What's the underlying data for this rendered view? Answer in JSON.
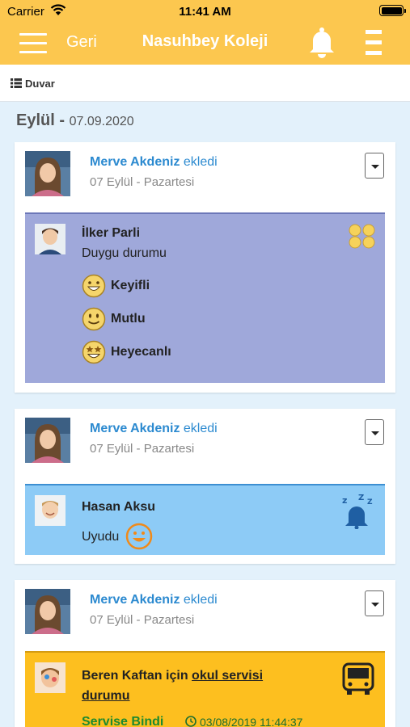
{
  "status": {
    "carrier": "Carrier",
    "time": "11:41 AM"
  },
  "nav": {
    "back_label": "Geri",
    "title": "Nasuhbey Koleji"
  },
  "section": {
    "label": "Duvar"
  },
  "date_header": {
    "month": "Eylül -",
    "date": "07.09.2020"
  },
  "posts": [
    {
      "author": "Merve Akdeniz",
      "action": "ekledi",
      "date": "07 Eylül - Pazartesi",
      "student": "İlker Parli",
      "subtitle": "Duygu durumu",
      "moods": [
        "Keyifli",
        "Mutlu",
        "Heyecanlı"
      ],
      "panel_color": "#9fa8da"
    },
    {
      "author": "Merve Akdeniz",
      "action": "ekledi",
      "date": "07 Eylül - Pazartesi",
      "student": "Hasan Aksu",
      "subtitle": "Uyudu",
      "panel_color": "#8dcbf6"
    },
    {
      "author": "Merve Akdeniz",
      "action": "ekledi",
      "date": "07 Eylül - Pazartesi",
      "student_line_prefix": "Beren Kaftan için",
      "link_text_1": "okul servisi",
      "link_text_2": "durumu",
      "status": "Servise Bindi",
      "timestamp": "03/08/2019 11:44:37",
      "panel_color": "#fdbf1f"
    }
  ],
  "colors": {
    "accent": "#fcc74f",
    "link": "#2c8ad0",
    "background": "#e3f1fb"
  }
}
